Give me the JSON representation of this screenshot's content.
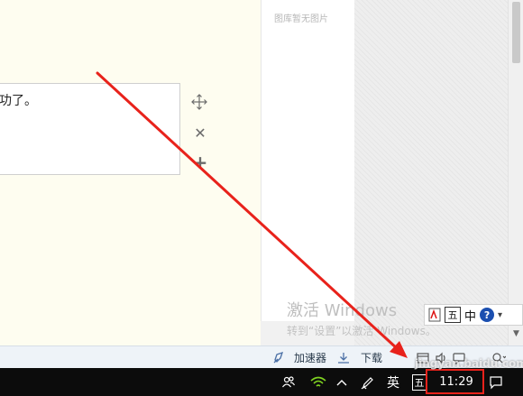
{
  "document": {
    "text_box_content": "功了。"
  },
  "image_panel": {
    "no_image_text": "图库暂无图片"
  },
  "activation": {
    "title": "激活 Windows",
    "subtitle": "转到“设置”以激活 Windows。"
  },
  "ime_toolbar": {
    "wubi": "五",
    "chinese": "中",
    "help": "?",
    "more": "▾"
  },
  "status_bar": {
    "accelerator_label": "加速器",
    "download_label": "下载"
  },
  "taskbar": {
    "ime_mode": "英",
    "wubi": "五",
    "clock": "11:29"
  },
  "watermark": {
    "text": "jingyan.baidu.com"
  },
  "colors": {
    "annotation_red": "#e8221b",
    "document_bg": "#fefdf0",
    "taskbar_bg": "#0c0c0c"
  }
}
